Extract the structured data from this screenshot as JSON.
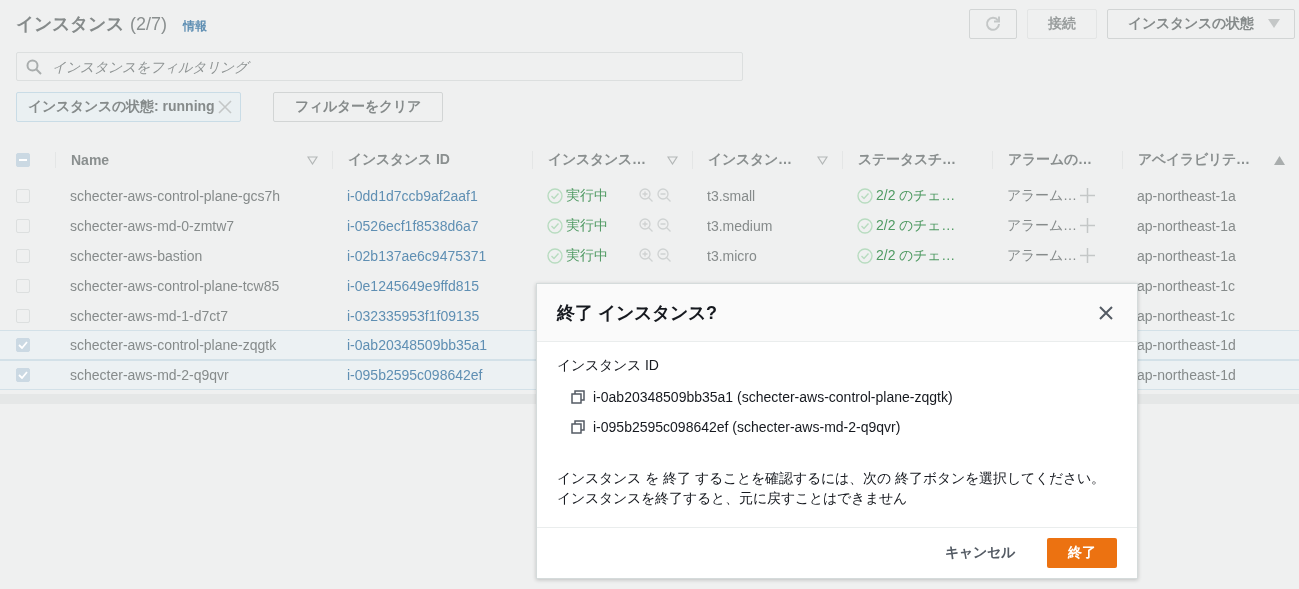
{
  "header": {
    "title": "インスタンス",
    "count": "(2/7)",
    "info_link": "情報"
  },
  "toolbar": {
    "connect": {
      "label": "接続",
      "disabled": true
    },
    "state_menu": {
      "label": "インスタンスの状態"
    }
  },
  "search": {
    "placeholder": "インスタンスをフィルタリング"
  },
  "filter_chip": {
    "label": "インスタンスの状態: running"
  },
  "clear_filters": {
    "label": "フィルターをクリア"
  },
  "table": {
    "select_all": {
      "indeterminate": true
    },
    "columns": [
      {
        "label": "Name",
        "sorted": false
      },
      {
        "label": "インスタンス ID"
      },
      {
        "label": "インスタンス…",
        "sorted": false
      },
      {
        "label": "インスタン…",
        "sorted": false
      },
      {
        "label": "ステータスチ…"
      },
      {
        "label": "アラームの…"
      },
      {
        "label": "アベイラビリテ…",
        "sorted": true
      }
    ],
    "rows": [
      {
        "selected": false,
        "name": "schecter-aws-control-plane-gcs7h",
        "id": "i-0dd1d7ccb9af2aaf1",
        "state": "実行中",
        "type": "t3.small",
        "check": "2/2 のチェ…",
        "alarm": "アラーム…",
        "az": "ap-northeast-1a"
      },
      {
        "selected": false,
        "name": "schecter-aws-md-0-zmtw7",
        "id": "i-0526ecf1f8538d6a7",
        "state": "実行中",
        "type": "t3.medium",
        "check": "2/2 のチェ…",
        "alarm": "アラーム…",
        "az": "ap-northeast-1a"
      },
      {
        "selected": false,
        "name": "schecter-aws-bastion",
        "id": "i-02b137ae6c9475371",
        "state": "実行中",
        "type": "t3.micro",
        "check": "2/2 のチェ…",
        "alarm": "アラーム…",
        "az": "ap-northeast-1a"
      },
      {
        "selected": false,
        "name": "schecter-aws-control-plane-tcw85",
        "id": "i-0e1245649e9ffd815",
        "az": "ap-northeast-1c"
      },
      {
        "selected": false,
        "name": "schecter-aws-md-1-d7ct7",
        "id": "i-032335953f1f09135",
        "az": "ap-northeast-1c"
      },
      {
        "selected": true,
        "name": "schecter-aws-control-plane-zqgtk",
        "id": "i-0ab20348509bb35a1",
        "az": "ap-northeast-1d"
      },
      {
        "selected": true,
        "name": "schecter-aws-md-2-q9qvr",
        "id": "i-095b2595c098642ef",
        "az": "ap-northeast-1d"
      }
    ]
  },
  "dialog": {
    "title": "終了 インスタンス?",
    "list_label": "インスタンス ID",
    "items": [
      "i-0ab20348509bb35a1 (schecter-aws-control-plane-zqgtk)",
      "i-095b2595c098642ef (schecter-aws-md-2-q9qvr)"
    ],
    "message": [
      "インスタンス を 終了 することを確認するには、次の 終了ボタンを選択してください。",
      "インスタンスを終了すると、元に戻すことはできません"
    ],
    "cancel": "キャンセル",
    "confirm": "終了"
  }
}
